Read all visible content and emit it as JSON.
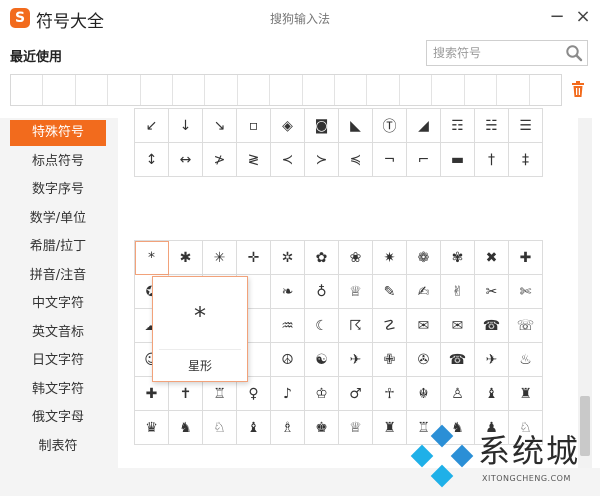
{
  "window": {
    "app_title": "符号大全",
    "ime_name": "搜狗输入法",
    "logo_letter": "S",
    "minimize": "−",
    "close": "×"
  },
  "recent": {
    "label": "最近使用",
    "cells": 17
  },
  "search": {
    "placeholder": "搜索符号",
    "value": ""
  },
  "categories": [
    {
      "label": "特殊符号",
      "active": true
    },
    {
      "label": "标点符号",
      "active": false
    },
    {
      "label": "数字序号",
      "active": false
    },
    {
      "label": "数学/单位",
      "active": false
    },
    {
      "label": "希腊/拉丁",
      "active": false
    },
    {
      "label": "拼音/注音",
      "active": false
    },
    {
      "label": "中文字符",
      "active": false
    },
    {
      "label": "英文音标",
      "active": false
    },
    {
      "label": "日文字符",
      "active": false
    },
    {
      "label": "韩文字符",
      "active": false
    },
    {
      "label": "俄文字母",
      "active": false
    },
    {
      "label": "制表符",
      "active": false
    }
  ],
  "arrow_grid": [
    [
      "↙",
      "↓",
      "↘",
      "▫",
      "◈",
      "◙",
      "◣",
      "Ⓣ",
      "◢",
      "☶",
      "☵",
      "☰"
    ],
    [
      "↕",
      "↔",
      "≯",
      "≷",
      "≺",
      "≻",
      "≼",
      "¬",
      "⌐",
      "▬",
      "†",
      "‡"
    ]
  ],
  "star_grid": [
    [
      "*",
      "✱",
      "✳",
      "✛",
      "✲",
      "✿",
      "❀",
      "✷",
      "❁",
      "✾",
      "✖",
      "✚"
    ],
    [
      "✪",
      "",
      "",
      "",
      "❧",
      "♁",
      "♕",
      "✎",
      "✍",
      "✌",
      "✂",
      "✄"
    ],
    [
      "☁",
      "",
      "",
      "",
      "♒",
      "☾",
      "☈",
      "☡",
      "✉",
      "✉",
      "☎",
      "☏"
    ],
    [
      "☺",
      "",
      "",
      "",
      "☮",
      "☯",
      "✈",
      "✙",
      "✇",
      "☎",
      "✈",
      "♨"
    ],
    [
      "✚",
      "✝",
      "♖",
      "♀",
      "♪",
      "♔",
      "♂",
      "☥",
      "☬",
      "♙",
      "♝",
      "♜"
    ],
    [
      "♛",
      "♞",
      "♘",
      "♝",
      "♗",
      "♚",
      "♕",
      "♜",
      "♖",
      "♞",
      "♟",
      "♘"
    ]
  ],
  "preview": {
    "symbol": "*",
    "name": "星形"
  },
  "watermark": {
    "text": "系统城",
    "sub": "XITONGCHENG.COM",
    "colors": [
      "#2b8fd6",
      "#1fb0e8",
      "#2b8fd6",
      "#1fb0e8"
    ]
  },
  "colors": {
    "accent": "#f26b1d",
    "border": "#dcdcdc"
  }
}
